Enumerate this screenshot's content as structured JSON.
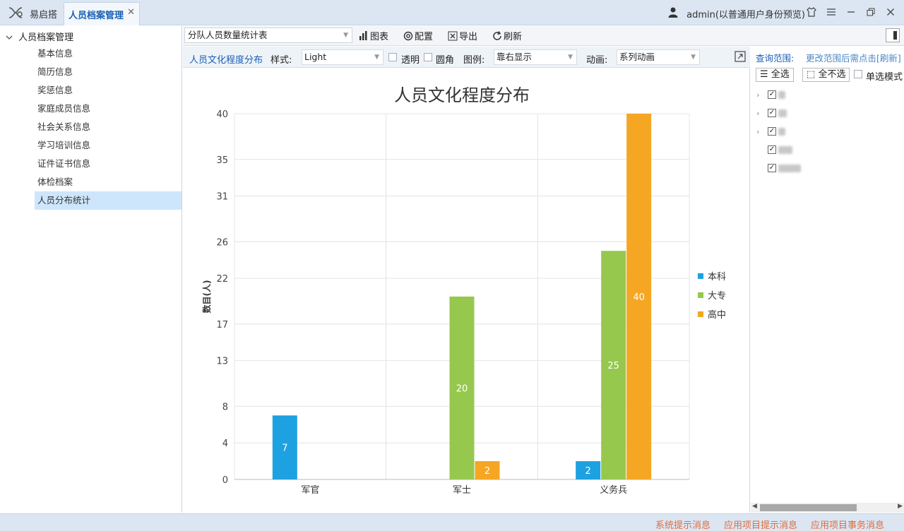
{
  "app": {
    "name": "易启搭",
    "tab_label": "人员档案管理",
    "tab_close": "✕",
    "user": "admin(以普通用户身份预览)"
  },
  "sidebar": {
    "root": "人员档案管理",
    "items": [
      {
        "label": "基本信息"
      },
      {
        "label": "简历信息"
      },
      {
        "label": "奖惩信息"
      },
      {
        "label": "家庭成员信息"
      },
      {
        "label": "社会关系信息"
      },
      {
        "label": "学习培训信息"
      },
      {
        "label": "证件证书信息"
      },
      {
        "label": "体检档案"
      },
      {
        "label": "人员分布统计",
        "selected": true
      }
    ]
  },
  "toolbar": {
    "report_select": "分队人员数量统计表",
    "chart_label": "图表",
    "config_label": "配置",
    "export_label": "导出",
    "refresh_label": "刷新"
  },
  "chart_options": {
    "title": "人员文化程度分布",
    "style_label": "样式:",
    "style_value": "Light",
    "transparent_label": "透明",
    "round_label": "圆角",
    "legend_label": "图例:",
    "legend_value": "靠右显示",
    "animation_label": "动画:",
    "animation_value": "系列动画"
  },
  "chart_data": {
    "type": "bar",
    "title": "人员文化程度分布",
    "ylabel": "数目(人)",
    "xlabel": "",
    "categories": [
      "军官",
      "军士",
      "义务兵"
    ],
    "ylim": [
      0,
      40
    ],
    "yticks": [
      0,
      4,
      8,
      13,
      17,
      22,
      26,
      31,
      35,
      40
    ],
    "series": [
      {
        "name": "本科",
        "color": "#1ea1e0",
        "values": [
          7,
          0,
          2
        ]
      },
      {
        "name": "大专",
        "color": "#96c84e",
        "values": [
          0,
          20,
          25
        ]
      },
      {
        "name": "高中",
        "color": "#f5a623",
        "values": [
          0,
          2,
          40
        ]
      }
    ],
    "legend_position": "right",
    "grid": true
  },
  "right_panel": {
    "scope_label": "查询范围:",
    "scope_hint": "更改范围后需点击[刷新]",
    "select_all": "全选",
    "select_none": "全不选",
    "single_mode": "单选模式"
  },
  "status": {
    "system_msg": "系统提示消息",
    "project_msg": "应用项目提示消息",
    "project_task": "应用项目事务消息"
  }
}
